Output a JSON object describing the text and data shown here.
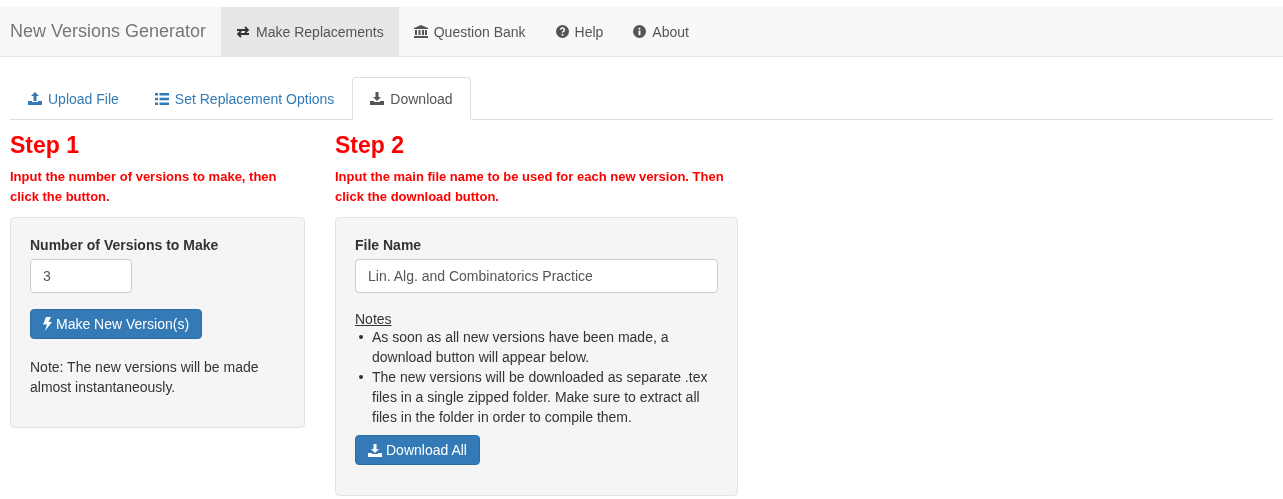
{
  "navbar": {
    "brand": "New Versions Generator",
    "items": [
      {
        "label": "Make Replacements",
        "kind": "swap",
        "selected": true
      },
      {
        "label": "Question Bank",
        "kind": "bank",
        "selected": false
      },
      {
        "label": "Help",
        "kind": "question",
        "selected": false
      },
      {
        "label": "About",
        "kind": "info",
        "selected": false
      }
    ]
  },
  "tabs": [
    {
      "label": "Upload File",
      "kind": "upload",
      "selected": false
    },
    {
      "label": "Set Replacement Options",
      "kind": "list",
      "selected": false
    },
    {
      "label": "Download",
      "kind": "download",
      "selected": true
    }
  ],
  "steps": [
    {
      "title": "Step 1",
      "instruction": "Input the number of versions to make, then click the button.",
      "field_label": "Number of Versions to Make",
      "field_value": "3",
      "button": {
        "label": "Make New Version(s)",
        "kind": "bolt"
      },
      "note": "Note: The new versions will be made almost instantaneously."
    },
    {
      "title": "Step 2",
      "instruction": "Input the main file name to be used for each new version. Then click the download button.",
      "field_label": "File Name",
      "field_value": "Lin. Alg. and Combinatorics Practice",
      "notes_heading": "Notes",
      "notes": [
        "As soon as all new versions have been made, a download button will appear below.",
        "The new versions will be downloaded as separate .tex files in a single zipped folder. Make sure to extract all files in the folder in order to compile them."
      ],
      "button": {
        "label": "Download All",
        "kind": "download"
      }
    }
  ]
}
